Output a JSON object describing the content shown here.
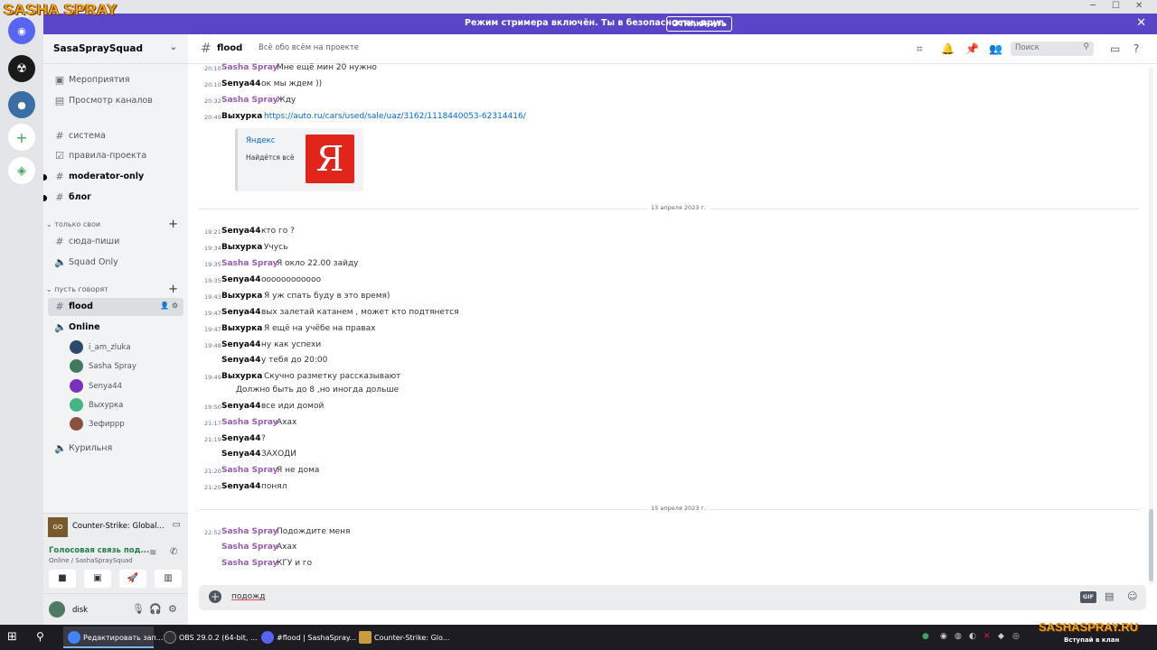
{
  "overlay": {
    "logo": "SASHA SPRAY",
    "brand": "SASHASPRAY.RU",
    "brand_sub": "Вступай в клан"
  },
  "window": {
    "minimize": "─",
    "maximize": "☐",
    "close": "✕"
  },
  "banner": {
    "text": "Режим стримера включён. Ты в безопасности, друг.",
    "button": "Отключить",
    "close": "✕"
  },
  "server": {
    "name": "SasaSpraySquad",
    "chevron": "⌄"
  },
  "sidebar": {
    "top_items": [
      {
        "icon": "▣",
        "label": "Мероприятия"
      },
      {
        "icon": "▤",
        "label": "Просмотр каналов"
      }
    ],
    "channels": [
      {
        "icon": "#",
        "label": "система"
      },
      {
        "icon": "☑",
        "label": "правила-проекта"
      },
      {
        "icon": "#",
        "label": "moderator-only"
      },
      {
        "icon": "#",
        "label": "блог"
      }
    ],
    "cat1": {
      "label": "только свои",
      "plus": "+"
    },
    "cat1_channels": [
      {
        "icon": "#",
        "label": "сюда-пиши"
      },
      {
        "icon": "🔈",
        "label": "Squad Only"
      }
    ],
    "cat2": {
      "label": "пусть говорят",
      "plus": "+"
    },
    "active_channel": {
      "icon": "#",
      "label": "flood",
      "icons": "👤 ⚙"
    },
    "voice_channel": {
      "icon": "🔈",
      "label": "Online"
    },
    "voice_users": [
      {
        "name": "i_am_zluka",
        "color": "#2c4a6a"
      },
      {
        "name": "Sasha Spray",
        "color": "#3d7a5e"
      },
      {
        "name": "Senya44",
        "color": "#7b2fbe"
      },
      {
        "name": "Выхурка",
        "color": "#43b581"
      },
      {
        "name": "Зефиррр",
        "color": "#8a5040"
      }
    ],
    "last_channel": {
      "icon": "🔈",
      "label": "Курильня"
    }
  },
  "game": {
    "icon": "GO",
    "title": "Counter-Strike: Global..."
  },
  "voice": {
    "status": "Голосовая связь под...",
    "sub": "Online / SashaSpraySquad"
  },
  "user": {
    "name": "disk"
  },
  "header": {
    "hash": "#",
    "name": "flood",
    "topic": "Всё обо всём на проекте",
    "search_placeholder": "Поиск"
  },
  "messages_before": [
    {
      "time": "20:10",
      "author": "Sasha Spray",
      "kind": "sasha",
      "text": "Мне ещё мин 20 нужно"
    },
    {
      "time": "20:10",
      "author": "Senya44",
      "kind": "senya",
      "text": "ок мы ждем ))"
    },
    {
      "time": "20:32",
      "author": "Sasha Spray",
      "kind": "sasha",
      "text": "Жду"
    },
    {
      "time": "20:49",
      "author": "Выхурка",
      "kind": "vyh",
      "text": "https://auto.ru/cars/used/sale/uaz/3162/1118440053-62314416/",
      "link": true
    }
  ],
  "embed": {
    "title": "Яндекс",
    "desc": "Найдётся всё",
    "logo": "Я"
  },
  "divider1": "13 апреля 2023 г.",
  "messages_mid": [
    {
      "time": "19:21",
      "author": "Senya44",
      "kind": "senya",
      "text": "кто го ?"
    },
    {
      "time": "19:34",
      "author": "Выхурка",
      "kind": "vyh",
      "text": "Учусь"
    },
    {
      "time": "19:35",
      "author": "Sasha Spray",
      "kind": "sasha",
      "text": "Я окло 22.00 зайду"
    },
    {
      "time": "19:35",
      "author": "Senya44",
      "kind": "senya",
      "text": "оооооооооооо"
    },
    {
      "time": "19:43",
      "author": "Выхурка",
      "kind": "vyh",
      "text": "Я уж спать буду в это время)"
    },
    {
      "time": "19:47",
      "author": "Senya44",
      "kind": "senya",
      "text": "вых залетай катанем , может кто подтянется"
    },
    {
      "time": "19:47",
      "author": "Выхурка",
      "kind": "vyh",
      "text": "Я ещё на учёбе на правах"
    },
    {
      "time": "19:48",
      "author": "Senya44",
      "kind": "senya",
      "text": "ну как успехи"
    },
    {
      "time": "",
      "author": "Senya44",
      "kind": "senya",
      "text": "у тебя до 20:00"
    },
    {
      "time": "19:49",
      "author": "Выхурка",
      "kind": "vyh",
      "text": "Скучно разметку рассказывают"
    },
    {
      "time": "",
      "author": "",
      "kind": "cont",
      "text": "Должно быть до 8 ,но иногда дольше"
    },
    {
      "time": "19:50",
      "author": "Senya44",
      "kind": "senya",
      "text": "все иди домой"
    },
    {
      "time": "21:17",
      "author": "Sasha Spray",
      "kind": "sasha",
      "text": "Ахах"
    },
    {
      "time": "21:19",
      "author": "Senya44",
      "kind": "senya",
      "text": "?"
    },
    {
      "time": "",
      "author": "Senya44",
      "kind": "senya",
      "text": "ЗАХОДИ"
    },
    {
      "time": "21:20",
      "author": "Sasha Spray",
      "kind": "sasha",
      "text": "Я не дома"
    },
    {
      "time": "21:20",
      "author": "Senya44",
      "kind": "senya",
      "text": "понял"
    }
  ],
  "divider2": "15 апреля 2023 г.",
  "messages_after": [
    {
      "time": "22:52",
      "author": "Sasha Spray",
      "kind": "sasha",
      "text": "Подождите меня"
    },
    {
      "time": "",
      "author": "Sasha Spray",
      "kind": "sasha",
      "text": "Ахах"
    },
    {
      "time": "",
      "author": "Sasha Spray",
      "kind": "sasha",
      "text": "КГУ и го"
    }
  ],
  "composer": {
    "plus": "+",
    "value": "подожд",
    "gif": "GIF"
  },
  "taskbar": {
    "items": [
      {
        "label": "Редактировать зап...",
        "color": "#4285f4",
        "active": true
      },
      {
        "label": "OBS 29.0.2 (64-bit, ...",
        "color": "#302e31",
        "active": false
      },
      {
        "label": "#flood | SashaSpray...",
        "color": "#5865f2",
        "active": false
      },
      {
        "label": "Counter-Strike: Glo...",
        "color": "#c89b3c",
        "active": false
      }
    ]
  }
}
